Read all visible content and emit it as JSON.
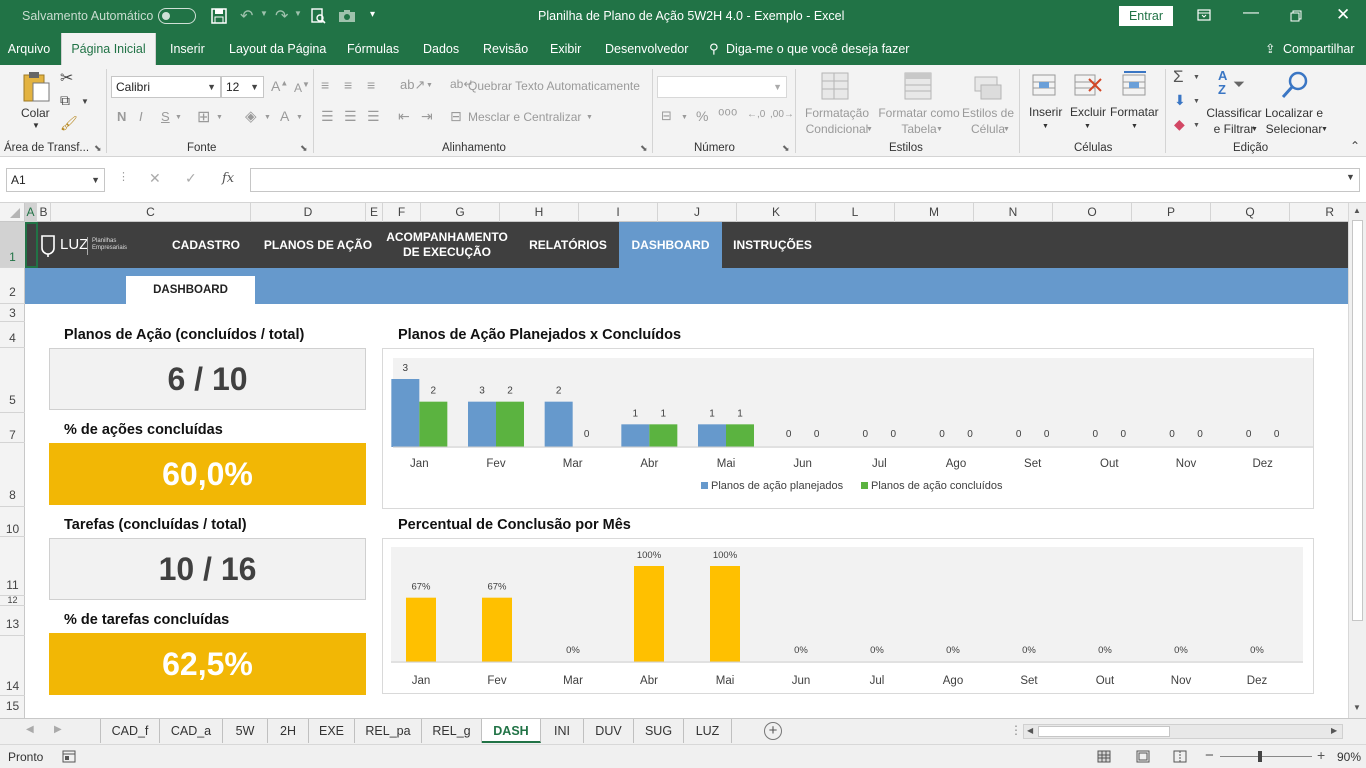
{
  "titlebar": {
    "autosave_label": "Salvamento Automático",
    "autosave_state": "off",
    "title": "Planilha de Plano de Ação 5W2H 4.0 - Exemplo  -  Excel",
    "signin_label": "Entrar"
  },
  "ribbon_tabs": [
    "Arquivo",
    "Página Inicial",
    "Inserir",
    "Layout da Página",
    "Fórmulas",
    "Dados",
    "Revisão",
    "Exibir",
    "Desenvolvedor"
  ],
  "active_ribbon_tab": "Página Inicial",
  "tellme_placeholder": "Diga-me o que você deseja fazer",
  "share_label": "Compartilhar",
  "ribbon": {
    "clipboard": {
      "paste_label": "Colar",
      "group_label": "Área de Transf..."
    },
    "font": {
      "font_name": "Calibri",
      "font_size": "12",
      "bold": "N",
      "italic": "I",
      "underline": "S",
      "group_label": "Fonte"
    },
    "alignment": {
      "wrap_label": "Quebrar Texto Automaticamente",
      "merge_label": "Mesclar e Centralizar",
      "group_label": "Alinhamento"
    },
    "number": {
      "format_value": "",
      "group_label": "Número"
    },
    "styles": {
      "cond_format": [
        "Formatação",
        "Condicional"
      ],
      "format_table": [
        "Formatar como",
        "Tabela"
      ],
      "cell_styles": [
        "Estilos de",
        "Célula"
      ],
      "group_label": "Estilos"
    },
    "cells": {
      "insert": "Inserir",
      "delete": "Excluir",
      "format": "Formatar",
      "group_label": "Células"
    },
    "editing": {
      "sort": [
        "Classificar",
        "e Filtrar"
      ],
      "find": [
        "Localizar e",
        "Selecionar"
      ],
      "group_label": "Edição"
    }
  },
  "formula_bar": {
    "name_box": "A1",
    "fx": "fx",
    "value": ""
  },
  "columns": [
    "A",
    "B",
    "C",
    "D",
    "E",
    "F",
    "G",
    "H",
    "I",
    "J",
    "K",
    "L",
    "M",
    "N",
    "O",
    "P",
    "Q",
    "R"
  ],
  "rows": [
    "1",
    "2",
    "3",
    "4",
    "5",
    "7",
    "8",
    "10",
    "11",
    "12",
    "13",
    "14",
    "15"
  ],
  "dashboard": {
    "logo_text": "LUZ",
    "logo_sub1": "Planilhas",
    "logo_sub2": "Empresariais",
    "nav": [
      {
        "label": "CADASTRO"
      },
      {
        "label": "PLANOS DE AÇÃO"
      },
      {
        "label": "ACOMPANHAMENTO\nDE EXECUÇÃO"
      },
      {
        "label": "RELATÓRIOS"
      },
      {
        "label": "DASHBOARD"
      },
      {
        "label": "INSTRUÇÕES"
      }
    ],
    "active_nav": "DASHBOARD",
    "subtab": "DASHBOARD",
    "kpis": [
      {
        "title": "Planos de Ação (concluídos / total)",
        "value": "6 / 10",
        "style": "gray"
      },
      {
        "title": "% de ações concluídas",
        "value": "60,0%",
        "style": "gold"
      },
      {
        "title": "Tarefas (concluídas / total)",
        "value": "10 / 16",
        "style": "gray"
      },
      {
        "title": "% de tarefas concluídas",
        "value": "62,5%",
        "style": "gold"
      }
    ],
    "chart1_title": "Planos de Ação Planejados x Concluídos",
    "chart2_title": "Percentual de Conclusão por Mês"
  },
  "chart_data": [
    {
      "type": "bar",
      "title": "Planos de Ação Planejados x Concluídos",
      "categories": [
        "Jan",
        "Fev",
        "Mar",
        "Abr",
        "Mai",
        "Jun",
        "Jul",
        "Ago",
        "Set",
        "Out",
        "Nov",
        "Dez"
      ],
      "series": [
        {
          "name": "Planos de ação planejados",
          "values": [
            3,
            2,
            2,
            1,
            1,
            0,
            0,
            0,
            0,
            0,
            0,
            0
          ],
          "color": "#6699cc"
        },
        {
          "name": "Planos de ação concluídos",
          "values": [
            2,
            2,
            0,
            1,
            1,
            0,
            0,
            0,
            0,
            0,
            0,
            0
          ],
          "color": "#5bb340"
        }
      ],
      "data_labels": [
        [
          "3",
          "3",
          "2",
          "1",
          "1",
          "0",
          "0",
          "0",
          "0",
          "0",
          "0",
          "0"
        ],
        [
          "2",
          "2",
          "0",
          "1",
          "1",
          "0",
          "0",
          "0",
          "0",
          "0",
          "0",
          "0"
        ]
      ],
      "ylim": [
        0,
        3
      ],
      "legend": "bottom",
      "grid": false
    },
    {
      "type": "bar",
      "title": "Percentual de Conclusão por Mês",
      "categories": [
        "Jan",
        "Fev",
        "Mar",
        "Abr",
        "Mai",
        "Jun",
        "Jul",
        "Ago",
        "Set",
        "Out",
        "Nov",
        "Dez"
      ],
      "values": [
        67,
        67,
        0,
        100,
        100,
        0,
        0,
        0,
        0,
        0,
        0,
        0
      ],
      "data_labels": [
        "67%",
        "67%",
        "0%",
        "100%",
        "100%",
        "0%",
        "0%",
        "0%",
        "0%",
        "0%",
        "0%",
        "0%"
      ],
      "color": "#ffc000",
      "ylim": [
        0,
        100
      ],
      "grid": false
    }
  ],
  "sheet_tabs": [
    "CAD_f",
    "CAD_a",
    "5W",
    "2H",
    "EXE",
    "REL_pa",
    "REL_g",
    "DASH",
    "INI",
    "DUV",
    "SUG",
    "LUZ"
  ],
  "active_sheet": "DASH",
  "status": {
    "ready": "Pronto",
    "zoom": "90%"
  }
}
